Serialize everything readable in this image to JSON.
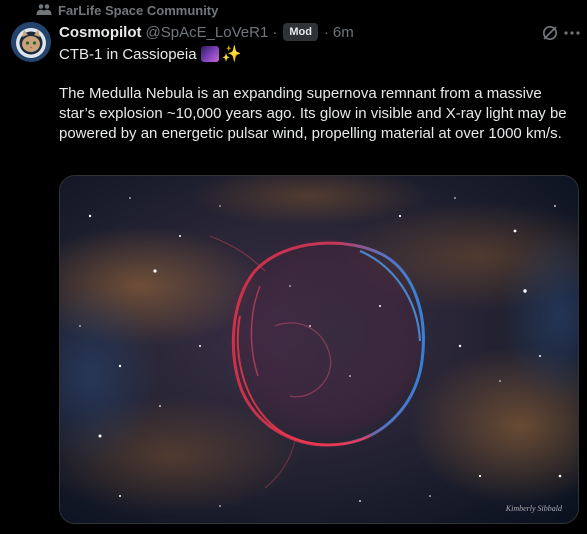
{
  "community": {
    "name": "FarLife Space Community",
    "icon": "community-icon"
  },
  "post": {
    "author": {
      "display_name": "Cosmopilot",
      "handle": "@SpAcE_LoVeR1",
      "badge": "Mod",
      "avatar": "astronaut-cat-avatar"
    },
    "separator": "·",
    "time": "6m",
    "title": "CTB-1 in Cassiopeia",
    "title_emojis": [
      "milky-way-emoji",
      "sparkles-emoji"
    ],
    "body": "The Medulla Nebula is an expanding supernova remnant from a massive star’s explosion ~10,000 years ago. Its glow in visible and X-ray light may be powered by an energetic pulsar wind, propelling material at over 1000 km/s.",
    "media": {
      "subject": "nebula-photo",
      "credit": "Kimberly Sibbald"
    }
  },
  "actions": {
    "grok": "grok-icon",
    "more": "more-icon"
  },
  "colors": {
    "background": "#000000",
    "text": "#e7e9ea",
    "muted": "#71767b",
    "badge_bg": "#2f3336"
  }
}
